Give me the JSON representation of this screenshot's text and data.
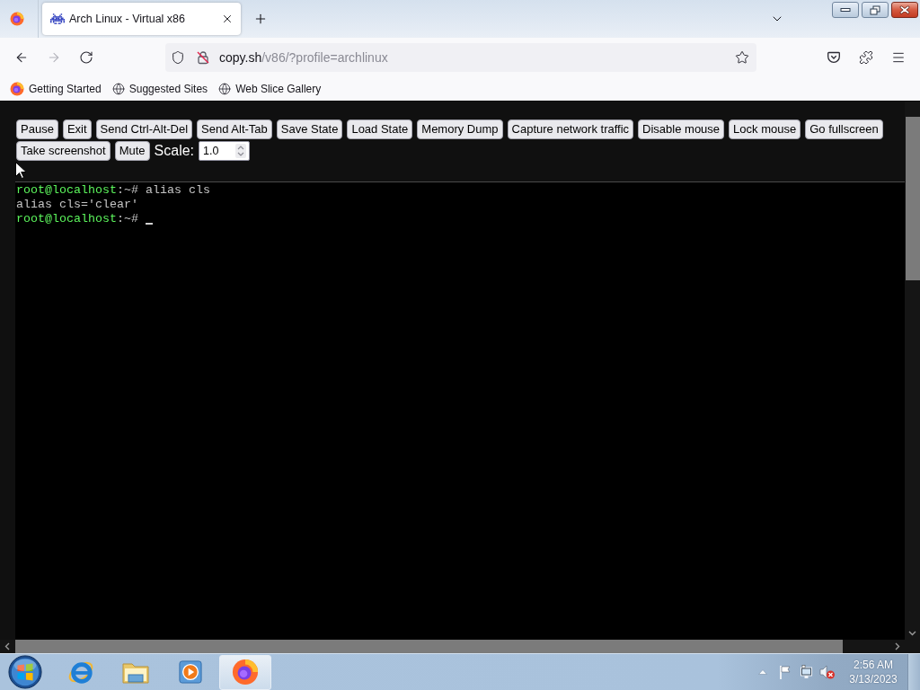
{
  "tabs": [
    {
      "title": "Arch Linux - Virtual x86",
      "selected": true
    }
  ],
  "nav_buttons": [
    {
      "kind": "back",
      "disabled": false
    },
    {
      "kind": "forward",
      "disabled": true
    },
    {
      "kind": "reload",
      "disabled": false
    }
  ],
  "address_bar": {
    "host": "copy.sh",
    "path": "/v86/?profile=archlinux"
  },
  "bookmarks": [
    {
      "kind": "firefox",
      "label": "Getting Started"
    },
    {
      "kind": "globe",
      "label": "Suggested Sites"
    },
    {
      "kind": "globe",
      "label": "Web Slice Gallery"
    }
  ],
  "page": {
    "buttons": [
      "Pause",
      "Exit",
      "Send Ctrl-Alt-Del",
      "Send Alt-Tab",
      "Save State",
      "Load State",
      "Memory Dump",
      "Capture network traffic",
      "Disable mouse",
      "Lock mouse",
      "Go fullscreen",
      "Take screenshot",
      "Mute"
    ],
    "scale": {
      "label": "Scale:",
      "value": "1.0"
    }
  },
  "terminal": {
    "lines": [
      {
        "kind": "prompt",
        "user_host": "root@localhost",
        "prompt_suffix": ":~#",
        "command": "alias cls",
        "cursor": false
      },
      {
        "kind": "output",
        "text": "alias cls='clear'",
        "cursor": false
      },
      {
        "kind": "prompt",
        "user_host": "root@localhost",
        "prompt_suffix": ":~#",
        "cursor": true
      }
    ]
  },
  "taskbar": {
    "apps": [
      {
        "kind": "browser_e",
        "selected": false
      },
      {
        "kind": "folder",
        "selected": false
      },
      {
        "kind": "player",
        "selected": false
      },
      {
        "kind": "browser_fox",
        "selected": true
      }
    ],
    "clock": {
      "time": "2:56 AM",
      "date": "3/13/2023"
    }
  }
}
